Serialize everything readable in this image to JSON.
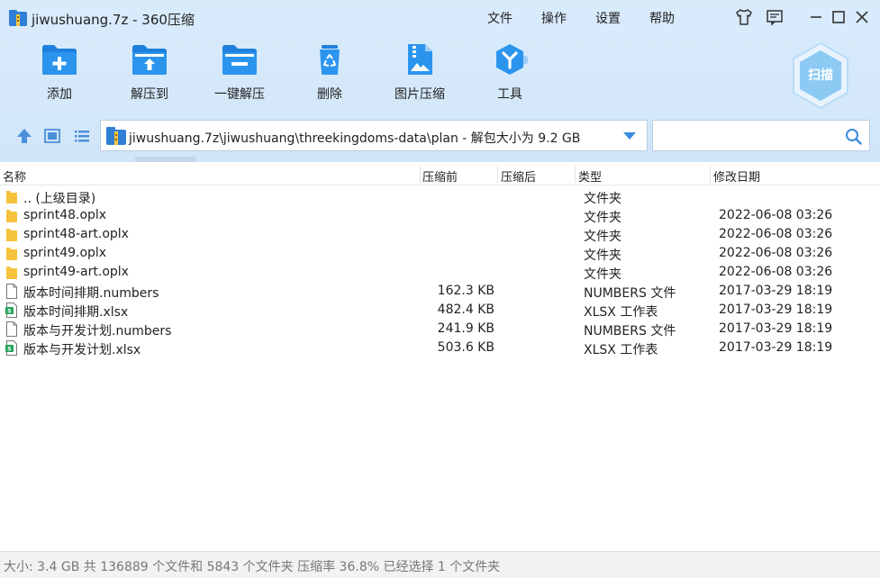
{
  "window": {
    "title": "jiwushuang.7z - 360压缩",
    "colors": {
      "accent": "#1e88e5",
      "top_bg": "#d6e9fa",
      "folder": "#f5c33b",
      "xlsx": "#23a35a"
    }
  },
  "menu": {
    "items": [
      "文件",
      "操作",
      "设置",
      "帮助"
    ]
  },
  "title_icons": [
    "tshirt-icon",
    "message-icon",
    "minimize-icon",
    "maximize-icon",
    "close-icon"
  ],
  "toolbar": {
    "items": [
      {
        "label": "添加",
        "icon": "add-folder-icon"
      },
      {
        "label": "解压到",
        "icon": "extract-folder-icon"
      },
      {
        "label": "一键解压",
        "icon": "one-click-extract-icon"
      },
      {
        "label": "删除",
        "icon": "recycle-bin-icon"
      },
      {
        "label": "图片压缩",
        "icon": "image-compress-icon"
      },
      {
        "label": "工具",
        "icon": "tools-icon"
      }
    ],
    "scan_label": "扫描"
  },
  "address": {
    "path": "jiwushuang.7z\\jiwushuang\\threekingdoms-data\\plan - 解包大小为 9.2 GB",
    "search_placeholder": ""
  },
  "columns": {
    "name": "名称",
    "before": "压缩前",
    "after": "压缩后",
    "type": "类型",
    "modified": "修改日期"
  },
  "files": [
    {
      "icon": "folder-icon",
      "name": ".. (上级目录)",
      "size": "",
      "type": "文件夹",
      "date": ""
    },
    {
      "icon": "folder-icon",
      "name": "sprint48.oplx",
      "size": "",
      "type": "文件夹",
      "date": "2022-06-08 03:26"
    },
    {
      "icon": "folder-icon",
      "name": "sprint48-art.oplx",
      "size": "",
      "type": "文件夹",
      "date": "2022-06-08 03:26"
    },
    {
      "icon": "folder-icon",
      "name": "sprint49.oplx",
      "size": "",
      "type": "文件夹",
      "date": "2022-06-08 03:26"
    },
    {
      "icon": "folder-icon",
      "name": "sprint49-art.oplx",
      "size": "",
      "type": "文件夹",
      "date": "2022-06-08 03:26"
    },
    {
      "icon": "document-icon",
      "name": "版本时间排期.numbers",
      "size": "162.3 KB",
      "type": "NUMBERS 文件",
      "date": "2017-03-29 18:19"
    },
    {
      "icon": "spreadsheet-icon",
      "name": "版本时间排期.xlsx",
      "size": "482.4 KB",
      "type": "XLSX 工作表",
      "date": "2017-03-29 18:19"
    },
    {
      "icon": "document-icon",
      "name": "版本与开发计划.numbers",
      "size": "241.9 KB",
      "type": "NUMBERS 文件",
      "date": "2017-03-29 18:19"
    },
    {
      "icon": "spreadsheet-icon",
      "name": "版本与开发计划.xlsx",
      "size": "503.6 KB",
      "type": "XLSX 工作表",
      "date": "2017-03-29 18:19"
    }
  ],
  "status": {
    "text": "大小: 3.4 GB 共 136889 个文件和 5843 个文件夹 压缩率 36.8% 已经选择 1 个文件夹"
  }
}
